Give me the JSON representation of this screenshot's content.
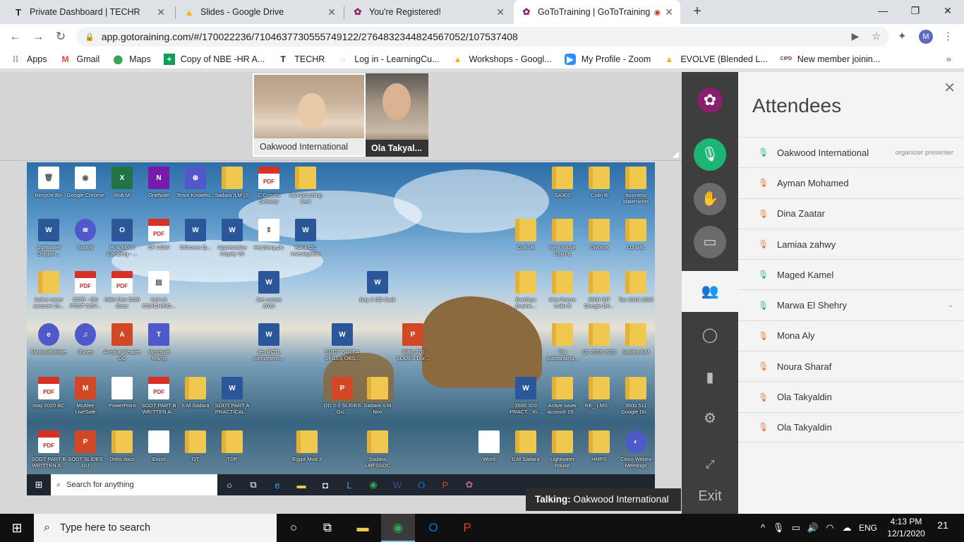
{
  "browser": {
    "tabs": [
      {
        "label": "Private Dashboard | TECHR",
        "icon": "T"
      },
      {
        "label": "Slides - Google Drive",
        "icon": "▲"
      },
      {
        "label": "You're Registered!",
        "icon": "✿"
      },
      {
        "label": "GoToTraining | GoToTraining",
        "icon": "✿"
      }
    ],
    "url": "app.gotoraining.com/#/170022236/7104637730555749122/2764832344824567052/107537408",
    "profile_initial": "M",
    "bookmarks": [
      "Apps",
      "Gmail",
      "Maps",
      "Copy of NBE -HR A...",
      "TECHR",
      "Log in - LearningCu...",
      "Workshops - Googl...",
      "My Profile - Zoom",
      "EVOLVE (Blended L...",
      "New member joinin..."
    ]
  },
  "cameras": [
    {
      "name": "Oakwood International"
    },
    {
      "name": "Ola Takyal..."
    }
  ],
  "desktop": {
    "icons": [
      {
        "cap": "Recycle Bin",
        "type": "blank",
        "g": "🗑"
      },
      {
        "cap": "Google Chrome",
        "type": "blank",
        "g": "◉"
      },
      {
        "cap": "Rob M",
        "type": "excel",
        "g": "X"
      },
      {
        "cap": "OneNote",
        "type": "onenote",
        "g": "N"
      },
      {
        "cap": "Team Knowho...",
        "type": "teams",
        "g": "⊕"
      },
      {
        "cap": "Sadara ILM (2)",
        "type": "folder",
        "g": ""
      },
      {
        "cap": "C Groves Delivery",
        "type": "pdf",
        "g": "PDF"
      },
      {
        "cap": "ILM Coaching Cert",
        "type": "folder",
        "g": ""
      },
      {
        "cap": "Lightwater Outgoin...",
        "type": "word",
        "g": "W"
      },
      {
        "cap": "Spotify",
        "type": "round",
        "g": "≋"
      },
      {
        "cap": "Pink Moon Camping - ...",
        "type": "word",
        "g": "O"
      },
      {
        "cap": "CF COW",
        "type": "pdf",
        "g": "PDF"
      },
      {
        "cap": "DGroves Q...",
        "type": "word",
        "g": "W"
      },
      {
        "cap": "Appreciative Inquiry V8",
        "type": "word",
        "g": "W"
      },
      {
        "cap": "Herzberg plc",
        "type": "blank",
        "g": "⇕"
      },
      {
        "cap": "Bank CC investigation",
        "type": "word",
        "g": "W"
      },
      {
        "cap": "Active saver account 19...",
        "type": "folder",
        "g": ""
      },
      {
        "cap": "CIPD - OD POST COV...",
        "type": "pdf",
        "g": "PDF"
      },
      {
        "cap": "OBS Nov 2020 Docs",
        "type": "pdf",
        "g": "PDF"
      },
      {
        "cap": "ILM L5 COACHING...",
        "type": "blank",
        "g": "▤"
      },
      {
        "cap": "Jen comps 2020",
        "type": "word",
        "g": "W"
      },
      {
        "cap": "Day 2 OD Cadr",
        "type": "word",
        "g": "W"
      },
      {
        "cap": "Microsoft Edge",
        "type": "round",
        "g": "e"
      },
      {
        "cap": "iTunes",
        "type": "round",
        "g": "♫"
      },
      {
        "cap": "Acrobat Reader DC",
        "type": "ppt",
        "g": "A"
      },
      {
        "cap": "Microsoft Teams",
        "type": "teams",
        "g": "T"
      },
      {
        "cap": "Jen RCTL competenc...",
        "type": "word",
        "g": "W"
      },
      {
        "cap": "SODT PART A SKILLS OBS...",
        "type": "word",
        "g": "W"
      },
      {
        "cap": "3080-370 SLIDES Dur...",
        "type": "ppt",
        "g": "P"
      },
      {
        "cap": "may 2020 BC",
        "type": "pdf",
        "g": "PDF"
      },
      {
        "cap": "McAfee LiveSafe",
        "type": "ppt",
        "g": "M"
      },
      {
        "cap": "PowerPoint",
        "type": "blank",
        "g": ""
      },
      {
        "cap": "SODT PART B WRITTEN A...",
        "type": "pdf",
        "g": "PDF"
      },
      {
        "cap": "ILM Sadara",
        "type": "folder",
        "g": ""
      },
      {
        "cap": "SODT PART A PRACTICAL...",
        "type": "word",
        "g": "W"
      },
      {
        "cap": "OD 2-2 SLIDES Gu...",
        "type": "ppt",
        "g": "P"
      },
      {
        "cap": "Sadara ILM Nov",
        "type": "folder",
        "g": ""
      },
      {
        "cap": "SODT PART B WRITTEN A...",
        "type": "pdf",
        "g": "PDF"
      },
      {
        "cap": "SODT SLIDES GU",
        "type": "ppt",
        "g": "P"
      },
      {
        "cap": "Debs docs",
        "type": "folder",
        "g": ""
      },
      {
        "cap": "Excel",
        "type": "blank",
        "g": ""
      },
      {
        "cap": "OT",
        "type": "folder",
        "g": ""
      },
      {
        "cap": "TDP",
        "type": "folder",
        "g": ""
      },
      {
        "cap": "Egypt Mod 3",
        "type": "folder",
        "g": ""
      },
      {
        "cap": "Sadara LMFSSDC",
        "type": "folder",
        "g": ""
      },
      {
        "cap": "Word",
        "type": "blank",
        "g": ""
      },
      {
        "cap": "ILM Sadara",
        "type": "folder",
        "g": ""
      },
      {
        "cap": "Lightwater house",
        "type": "folder",
        "g": ""
      },
      {
        "cap": "HMPS",
        "type": "folder",
        "g": ""
      },
      {
        "cap": "Cisco Webex Meetings",
        "type": "round",
        "g": "◐"
      },
      {
        "cap": "SA302",
        "type": "folder",
        "g": ""
      },
      {
        "cap": "Colin B",
        "type": "folder",
        "g": ""
      },
      {
        "cap": "business statements",
        "type": "folder",
        "g": ""
      },
      {
        "cap": "Colin B",
        "type": "folder",
        "g": ""
      },
      {
        "cap": "New house Colin B",
        "type": "folder",
        "g": ""
      },
      {
        "cap": "Divorce",
        "type": "folder",
        "g": ""
      },
      {
        "cap": "O2 bills",
        "type": "folder",
        "g": ""
      },
      {
        "cap": "Barclays Busine...",
        "type": "folder",
        "g": ""
      },
      {
        "cap": "New house Colin B",
        "type": "folder",
        "g": ""
      },
      {
        "cap": "3500 307 Google Dri...",
        "type": "folder",
        "g": ""
      },
      {
        "cap": "Tax 2019 2020",
        "type": "folder",
        "g": ""
      },
      {
        "cap": "Tax outstanding...",
        "type": "folder",
        "g": ""
      },
      {
        "cap": "Q2 2019 2020",
        "type": "folder",
        "g": ""
      },
      {
        "cap": "Sadara ILM",
        "type": "folder",
        "g": ""
      },
      {
        "cap": "3500 320 PRACT... Ki...",
        "type": "word",
        "g": "W"
      },
      {
        "cap": "Active saver account 19...",
        "type": "folder",
        "g": ""
      },
      {
        "cap": "RE_ LMS ...",
        "type": "folder",
        "g": ""
      },
      {
        "cap": "3500 511 Google Dri...",
        "type": "folder",
        "g": ""
      }
    ],
    "taskbar_search": "Search for anything"
  },
  "talking": {
    "label": "Talking:",
    "name": "Oakwood International"
  },
  "rail": {
    "exit": "Exit"
  },
  "panel": {
    "title": "Attendees",
    "attendees": [
      {
        "name": "Oakwood International",
        "role": "organizer presenter",
        "mic": "on"
      },
      {
        "name": "Ayman Mohamed",
        "role": "",
        "mic": "off"
      },
      {
        "name": "Dina Zaatar",
        "role": "",
        "mic": "off"
      },
      {
        "name": "Lamiaa zahwy",
        "role": "",
        "mic": "off"
      },
      {
        "name": "Maged Kamel",
        "role": "",
        "mic": "on"
      },
      {
        "name": "Marwa El Shehry",
        "role": "",
        "mic": "on"
      },
      {
        "name": "Mona Aly",
        "role": "",
        "mic": "off"
      },
      {
        "name": "Noura Sharaf",
        "role": "",
        "mic": "off"
      },
      {
        "name": "Ola Takyaldin",
        "role": "",
        "mic": "off"
      },
      {
        "name": "Ola Takyaldin",
        "role": "",
        "mic": "off"
      }
    ]
  },
  "windows": {
    "search": "Type here to search",
    "lang": "ENG",
    "time": "4:13 PM",
    "date": "12/1/2020",
    "notifications": "21"
  }
}
